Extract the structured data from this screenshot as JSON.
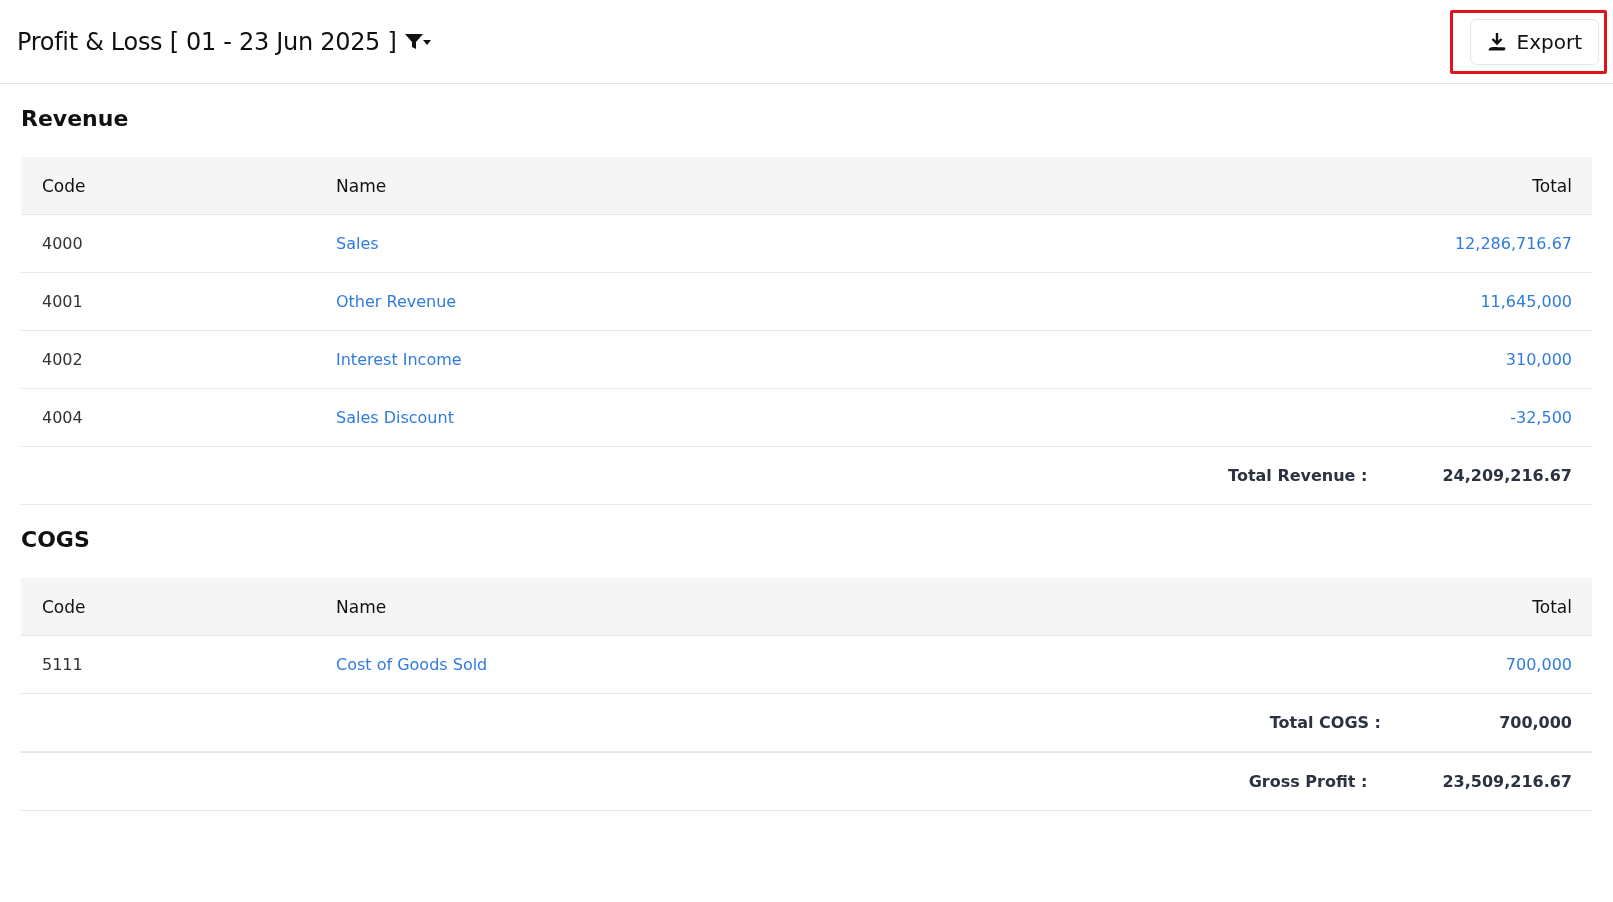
{
  "header": {
    "title": "Profit & Loss [ 01 - 23 Jun 2025 ]",
    "export_button": {
      "label": "Export",
      "highlighted": true
    }
  },
  "sections": [
    {
      "title": "Revenue",
      "columns": [
        "Code",
        "Name",
        "Total"
      ],
      "rows": [
        {
          "code": "4000",
          "name": "Sales",
          "total": "12,286,716.67"
        },
        {
          "code": "4001",
          "name": "Other Revenue",
          "total": "11,645,000"
        },
        {
          "code": "4002",
          "name": "Interest Income",
          "total": "310,000"
        },
        {
          "code": "4004",
          "name": "Sales Discount",
          "total": "-32,500"
        }
      ],
      "summaries": [
        {
          "label": "Total Revenue :",
          "value": "24,209,216.67"
        }
      ]
    },
    {
      "title": "COGS",
      "columns": [
        "Code",
        "Name",
        "Total"
      ],
      "rows": [
        {
          "code": "5111",
          "name": "Cost of Goods Sold",
          "total": "700,000"
        }
      ],
      "summaries": [
        {
          "label": "Total COGS :",
          "value": "700,000"
        },
        {
          "label": "Gross Profit :",
          "value": "23,509,216.67"
        }
      ]
    }
  ]
}
